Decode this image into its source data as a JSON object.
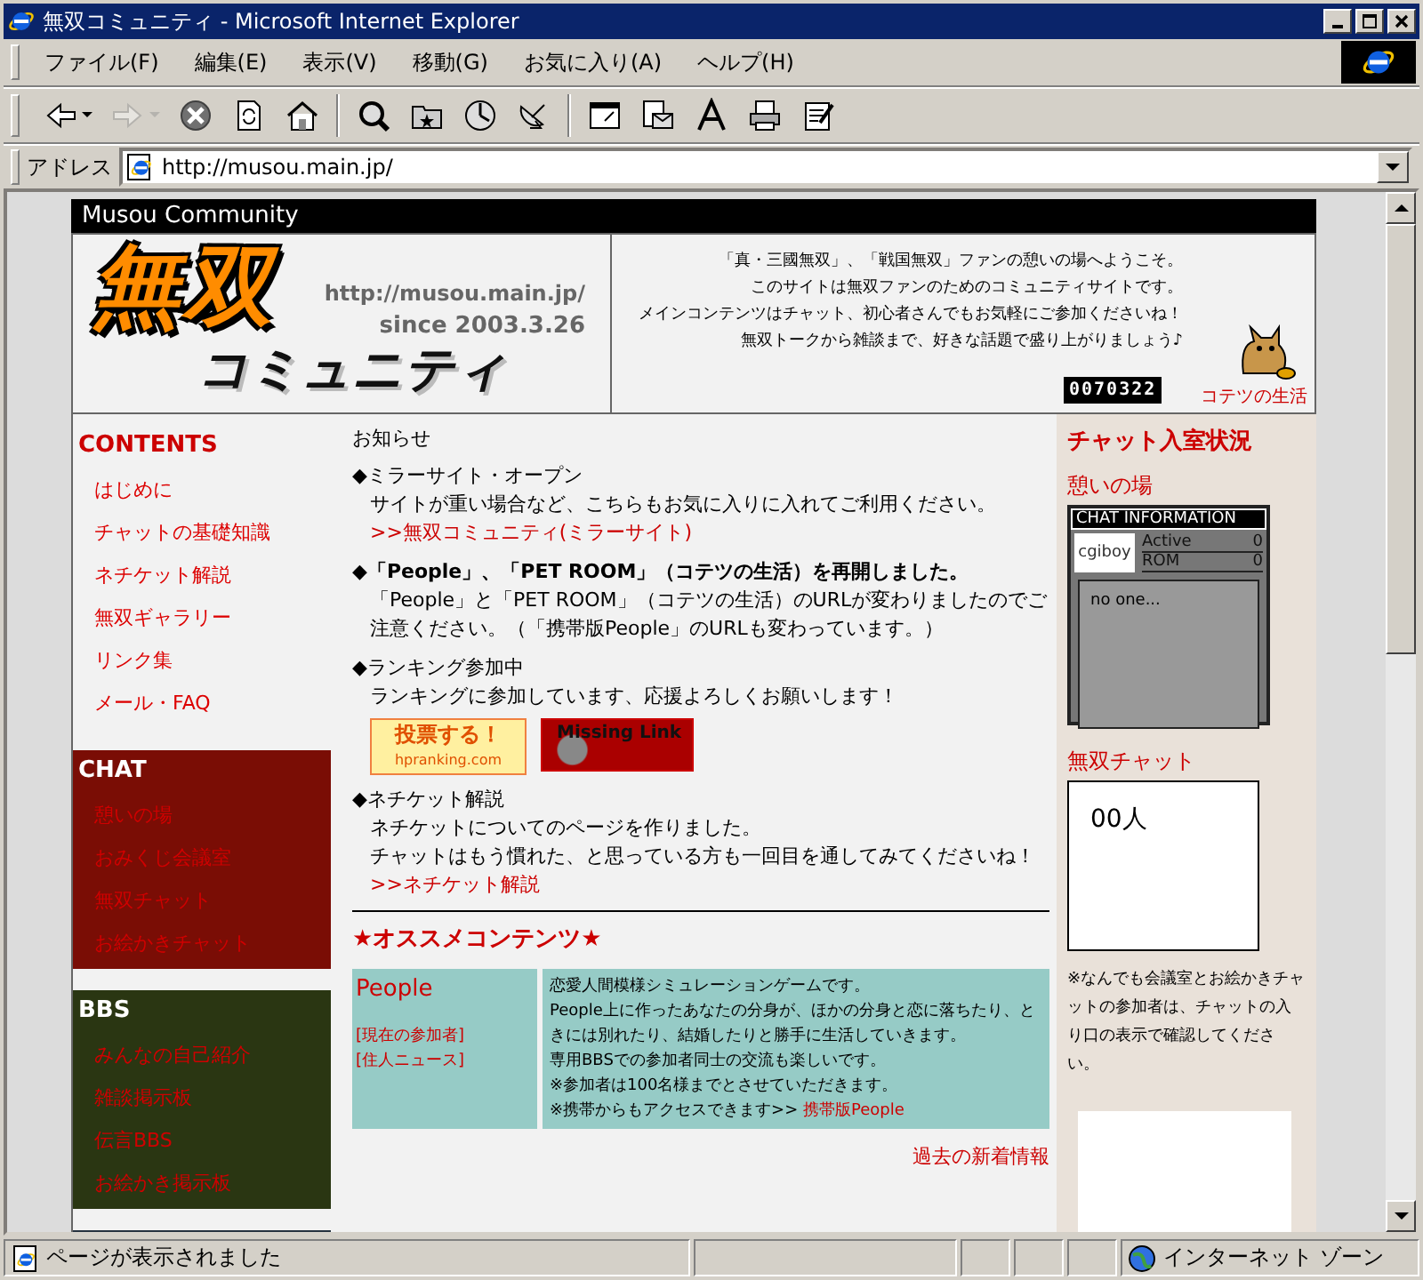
{
  "window": {
    "title": "無双コミュニティ - Microsoft Internet Explorer"
  },
  "menu": [
    {
      "label": "ファイル(F)"
    },
    {
      "label": "編集(E)"
    },
    {
      "label": "表示(V)"
    },
    {
      "label": "移動(G)"
    },
    {
      "label": "お気に入り(A)"
    },
    {
      "label": "ヘルプ(H)"
    }
  ],
  "toolbar": [
    {
      "kind": "back",
      "disabled": false
    },
    {
      "kind": "forward",
      "disabled": true
    },
    {
      "kind": "stop",
      "disabled": false
    },
    {
      "kind": "refresh",
      "disabled": false
    },
    {
      "kind": "home",
      "disabled": false
    },
    {
      "kind": "sep",
      "disabled": false
    },
    {
      "kind": "search",
      "disabled": false
    },
    {
      "kind": "favorites",
      "disabled": false
    },
    {
      "kind": "history",
      "disabled": false
    },
    {
      "kind": "channels",
      "disabled": false
    },
    {
      "kind": "sep",
      "disabled": false
    },
    {
      "kind": "fullscreen",
      "disabled": false
    },
    {
      "kind": "mail",
      "disabled": false
    },
    {
      "kind": "font",
      "disabled": false
    },
    {
      "kind": "print",
      "disabled": false
    },
    {
      "kind": "edit",
      "disabled": false
    }
  ],
  "address": {
    "label": "アドレス",
    "value": "http://musou.main.jp/"
  },
  "site": {
    "name": "Musou Community",
    "logo": {
      "title": "無双",
      "subtitle": "コミュニティ",
      "url": "http://musou.main.jp/",
      "since": "since 2003.3.26"
    },
    "intro": [
      "「真・三國無双」、「戦国無双」ファンの憩いの場へようこそ。",
      "このサイトは無双ファンのためのコミュニティサイトです。",
      "メインコンテンツはチャット、初心者さんでもお気軽にご参加くださいね！",
      "無双トークから雑談まで、好きな話題で盛り上がりましょう♪"
    ],
    "counter": "0070322",
    "pet_link": "コテツの生活"
  },
  "sidebar": [
    {
      "kind": "plain",
      "title": "CONTENTS",
      "items": [
        "はじめに",
        "チャットの基礎知識",
        "ネチケット解説",
        "無双ギャラリー",
        "リンク集",
        "メール・FAQ"
      ]
    },
    {
      "kind": "chat",
      "title": "CHAT",
      "items": [
        "憩いの場",
        "おみくじ会議室",
        "無双チャット",
        "お絵かきチャット"
      ]
    },
    {
      "kind": "bbs",
      "title": "BBS",
      "items": [
        "みんなの自己紹介",
        "雑談掲示板",
        "伝言BBS",
        "お絵かき掲示板"
      ]
    }
  ],
  "news": {
    "heading": "お知らせ",
    "items": [
      {
        "title": "◆ミラーサイト・オープン",
        "bold": false,
        "lines": [
          "サイトが重い場合など、こちらもお気に入りに入れてご利用ください。"
        ],
        "link": ">>無双コミュニティ(ミラーサイト)"
      },
      {
        "title": "◆「People」、「PET ROOM」（コテツの生活）を再開しました。",
        "bold": true,
        "lines": [
          "「People」と「PET ROOM」（コテツの生活）のURLが変わりましたのでご注意ください。（「携帯版People」のURLも変わっています。）"
        ]
      },
      {
        "title": "◆ランキング参加中",
        "bold": false,
        "lines": [
          "ランキングに参加しています、応援よろしくお願いします！"
        ],
        "banners": [
          {
            "kind": "vote",
            "text": "投票する！",
            "sub": "hpranking.com"
          },
          {
            "kind": "dark",
            "text": "Missing Link"
          }
        ]
      },
      {
        "title": "◆ネチケット解説",
        "bold": false,
        "lines": [
          "ネチケットについてのページを作りました。",
          "チャットはもう慣れた、と思っている方も一回目を通してみてくださいね！"
        ],
        "link": ">>ネチケット解説"
      }
    ]
  },
  "recommend": {
    "heading": "★オススメコンテンツ★",
    "title": "People",
    "links": [
      "[現在の参加者]",
      "[住人ニュース]"
    ],
    "lines": [
      "恋愛人間模様シミュレーションゲームです。",
      "People上に作ったあなたの分身が、ほかの分身と恋に落ちたり、ときには別れたり、結婚したりと勝手に生活していきます。",
      "専用BBSでの参加者同士の交流も楽しいです。",
      "※参加者は100名様までとさせていただきます。"
    ],
    "mobile_text": "※携帯からもアクセスできます>> ",
    "mobile_link": "携帯版People",
    "past_link": "過去の新着情報"
  },
  "chat_status": {
    "title": "チャット入室状況",
    "rooms": [
      {
        "kind": "widget",
        "name": "憩いの場",
        "header": "CHAT INFORMATION",
        "brand": "cgiboy",
        "stats": [
          {
            "label": "Active",
            "value": "0"
          },
          {
            "label": "ROM",
            "value": "0"
          }
        ],
        "members": "no one..."
      },
      {
        "kind": "count",
        "name": "無双チャット",
        "count": "00人"
      }
    ],
    "note": "※なんでも会議室とお絵かきチャットの参加者は、チャットの入り口の表示で確認してください。"
  },
  "status_bar": {
    "text": "ページが表示されました",
    "zone": "インターネット ゾーン"
  }
}
